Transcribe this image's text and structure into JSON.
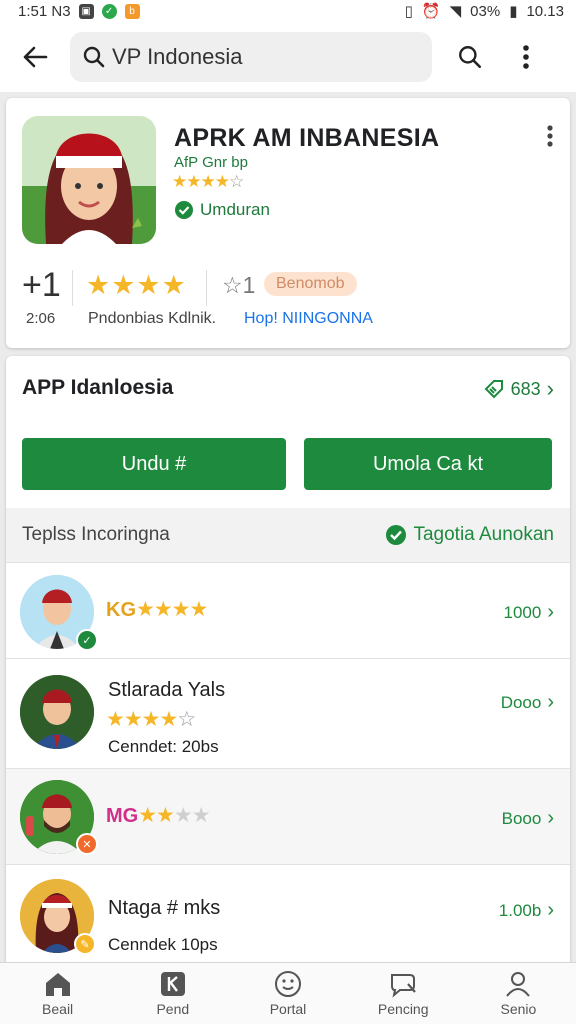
{
  "status_bar": {
    "time": "1:51 N3",
    "battery": "03%",
    "clock": "10.13"
  },
  "search": {
    "query": "VP Indonesia"
  },
  "app": {
    "title": "APRK AM INBANESIA",
    "developer": "AfP Gnr bp",
    "verified_label": "Umduran",
    "stat1_value": "+1",
    "stat1_label": "2:06",
    "stat2_label": "Pndonbias Kdlnik.",
    "stat3_value": "1",
    "stat3_badge": "Benomob",
    "stat3_label": "Hop! NIINGONNA"
  },
  "section": {
    "title": "APP Idanloesia",
    "link_count": "683",
    "button_primary": "Undu #",
    "button_secondary": "Umola Ca kt",
    "subheader_left": "Teplss Incoringna",
    "subheader_right": "Tagotia Aunokan"
  },
  "rows": [
    {
      "name": "KG",
      "rating": 4,
      "value": "1000",
      "sub": ""
    },
    {
      "name": "Stlarada Yals",
      "rating": 4,
      "value": "Dooo",
      "sub": "Cenndet: 20bs"
    },
    {
      "name": "MG",
      "rating": 3,
      "value": "Booo",
      "sub": ""
    },
    {
      "name": "Ntaga # mks",
      "rating": 0,
      "value": "1.00b",
      "sub": "Cenndek 10ps"
    }
  ],
  "nav": [
    {
      "label": "Beail",
      "icon": "home-icon"
    },
    {
      "label": "Pend",
      "icon": "bookmark-icon"
    },
    {
      "label": "Portal",
      "icon": "smiley-icon"
    },
    {
      "label": "Pencing",
      "icon": "chat-icon"
    },
    {
      "label": "Senio",
      "icon": "person-icon"
    }
  ],
  "colors": {
    "accent_green": "#1e8a3e",
    "star_gold": "#f5b628",
    "link_blue": "#1a73e8"
  }
}
